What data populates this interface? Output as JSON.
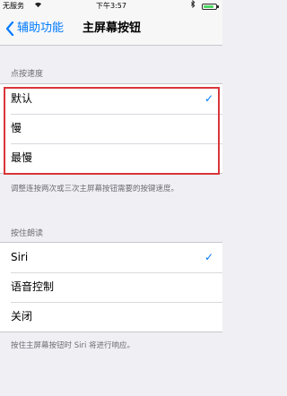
{
  "status_bar": {
    "carrier": "无服务",
    "time": "下午3:57"
  },
  "nav": {
    "back_label": "辅助功能",
    "title": "主屏幕按钮"
  },
  "click_speed": {
    "header": "点按速度",
    "options": [
      {
        "label": "默认",
        "checked": true
      },
      {
        "label": "慢",
        "checked": false
      },
      {
        "label": "最慢",
        "checked": false
      }
    ],
    "footer": "调整连按两次或三次主屏幕按钮需要的按键速度。"
  },
  "press_hold": {
    "header": "按住朗读",
    "options": [
      {
        "label": "Siri",
        "checked": true
      },
      {
        "label": "语音控制",
        "checked": false
      },
      {
        "label": "关闭",
        "checked": false
      }
    ],
    "footer": "按住主屏幕按钮时 Siri 将进行响应。"
  },
  "colors": {
    "accent": "#007aff",
    "highlight": "#d9353a",
    "battery": "#4cd964"
  },
  "icons": {
    "check": "checkmark-icon",
    "back": "chevron-left-icon",
    "wifi": "wifi-icon",
    "bluetooth": "bluetooth-icon"
  }
}
